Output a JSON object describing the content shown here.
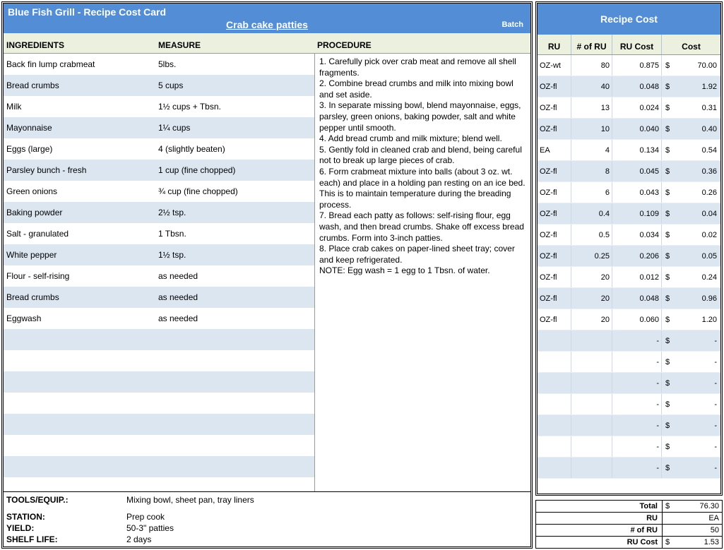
{
  "header": {
    "title": "Blue Fish Grill - Recipe Cost Card",
    "subtitle": "Crab cake patties",
    "batch": "Batch",
    "recipe_cost_title": "Recipe Cost"
  },
  "cols": {
    "ingredients": "INGREDIENTS",
    "measure": "MEASURE",
    "procedure": "PROCEDURE",
    "ru": "RU",
    "num_ru": "# of RU",
    "ru_cost": "RU Cost",
    "cost": "Cost"
  },
  "ingredients": [
    {
      "name": "Back fin lump crabmeat",
      "measure": "5lbs.",
      "ru": "OZ-wt",
      "num": "80",
      "rucost": "0.875",
      "cost": "70.00"
    },
    {
      "name": "Bread crumbs",
      "measure": "5 cups",
      "ru": "OZ-fl",
      "num": "40",
      "rucost": "0.048",
      "cost": "1.92"
    },
    {
      "name": "Milk",
      "measure": "1½ cups + Tbsn.",
      "ru": "OZ-fl",
      "num": "13",
      "rucost": "0.024",
      "cost": "0.31"
    },
    {
      "name": "Mayonnaise",
      "measure": "1¼ cups",
      "ru": "OZ-fl",
      "num": "10",
      "rucost": "0.040",
      "cost": "0.40"
    },
    {
      "name": "Eggs (large)",
      "measure": "4 (slightly beaten)",
      "ru": "EA",
      "num": "4",
      "rucost": "0.134",
      "cost": "0.54"
    },
    {
      "name": "Parsley bunch - fresh",
      "measure": "1 cup (fine chopped)",
      "ru": "OZ-fl",
      "num": "8",
      "rucost": "0.045",
      "cost": "0.36"
    },
    {
      "name": "Green onions",
      "measure": "¾ cup (fine chopped)",
      "ru": "OZ-fl",
      "num": "6",
      "rucost": "0.043",
      "cost": "0.26"
    },
    {
      "name": "Baking powder",
      "measure": "2½ tsp.",
      "ru": "OZ-fl",
      "num": "0.4",
      "rucost": "0.109",
      "cost": "0.04"
    },
    {
      "name": "Salt - granulated",
      "measure": "1 Tbsn.",
      "ru": "OZ-fl",
      "num": "0.5",
      "rucost": "0.034",
      "cost": "0.02"
    },
    {
      "name": "White pepper",
      "measure": "1½ tsp.",
      "ru": "OZ-fl",
      "num": "0.25",
      "rucost": "0.206",
      "cost": "0.05"
    },
    {
      "name": "Flour - self-rising",
      "measure": "as needed",
      "ru": "OZ-fl",
      "num": "20",
      "rucost": "0.012",
      "cost": "0.24"
    },
    {
      "name": "Bread crumbs",
      "measure": "as needed",
      "ru": "OZ-fl",
      "num": "20",
      "rucost": "0.048",
      "cost": "0.96"
    },
    {
      "name": "Eggwash",
      "measure": "as needed",
      "ru": "OZ-fl",
      "num": "20",
      "rucost": "0.060",
      "cost": "1.20"
    },
    {
      "name": "",
      "measure": "",
      "ru": "",
      "num": "",
      "rucost": "-",
      "cost": "-"
    },
    {
      "name": "",
      "measure": "",
      "ru": "",
      "num": "",
      "rucost": "-",
      "cost": "-"
    },
    {
      "name": "",
      "measure": "",
      "ru": "",
      "num": "",
      "rucost": "-",
      "cost": "-"
    },
    {
      "name": "",
      "measure": "",
      "ru": "",
      "num": "",
      "rucost": "-",
      "cost": "-"
    },
    {
      "name": "",
      "measure": "",
      "ru": "",
      "num": "",
      "rucost": "-",
      "cost": "-"
    },
    {
      "name": "",
      "measure": "",
      "ru": "",
      "num": "",
      "rucost": "-",
      "cost": "-"
    },
    {
      "name": "",
      "measure": "",
      "ru": "",
      "num": "",
      "rucost": "-",
      "cost": "-"
    }
  ],
  "procedure": [
    "1. Carefully pick over crab meat and remove all shell fragments.",
    "2. Combine bread crumbs and milk into mixing bowl and set aside.",
    "3. In separate missing bowl, blend mayonnaise, eggs, parsley, green onions, baking powder, salt and white pepper until smooth.",
    "4. Add bread crumb and milk mixture; blend well.",
    "5. Gently fold in cleaned crab and blend, being careful not to break up large pieces of crab.",
    "6. Form crabmeat mixture into balls (about 3 oz. wt. each) and place in a holding pan resting on an ice bed. This is to maintain temperature during the breading process.",
    "7. Bread each patty as follows: self-rising flour, egg wash, and then bread crumbs. Shake off excess bread crumbs. Form into 3-inch patties.",
    "8. Place crab cakes on paper-lined sheet tray; cover and keep refrigerated.",
    "NOTE: Egg wash = 1 egg to 1 Tbsn. of water."
  ],
  "footer": {
    "tools_lbl": "TOOLS/EQUIP.:",
    "tools": "Mixing bowl, sheet pan, tray liners",
    "station_lbl": "STATION:",
    "station": "Prep cook",
    "yield_lbl": "YIELD:",
    "yield": "50-3\" patties",
    "shelf_lbl": "SHELF LIFE:",
    "shelf": "2 days"
  },
  "totals": {
    "total_lbl": "Total",
    "total": "76.30",
    "ru_lbl": "RU",
    "ru": "EA",
    "numru_lbl": "# of RU",
    "numru": "50",
    "rucost_lbl": "RU Cost",
    "rucost": "1.53",
    "dollar": "$"
  }
}
